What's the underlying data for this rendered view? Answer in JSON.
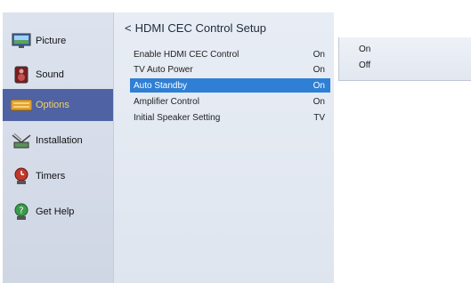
{
  "sidebar": {
    "items": [
      {
        "label": "Picture",
        "icon": "picture-icon",
        "selected": false
      },
      {
        "label": "Sound",
        "icon": "sound-icon",
        "selected": false
      },
      {
        "label": "Options",
        "icon": "options-icon",
        "selected": true
      },
      {
        "label": "Installation",
        "icon": "installation-icon",
        "selected": false
      },
      {
        "label": "Timers",
        "icon": "timers-icon",
        "selected": false
      },
      {
        "label": "Get Help",
        "icon": "help-icon",
        "selected": false
      }
    ]
  },
  "panel": {
    "back_glyph": "<",
    "title": "HDMI CEC Control Setup",
    "rows": [
      {
        "label": "Enable HDMI CEC  Control",
        "value": "On"
      },
      {
        "label": "TV Auto Power",
        "value": "On"
      },
      {
        "label": "Auto  Standby",
        "value": "On"
      },
      {
        "label": "Amplifier Control",
        "value": "On"
      },
      {
        "label": "Initial Speaker Setting",
        "value": "TV"
      }
    ],
    "highlighted_row": "Auto  Standby"
  },
  "popup": {
    "options": [
      "On",
      "Off"
    ]
  },
  "colors": {
    "highlight": "#2f7fd4",
    "sidebar_selected": "#4f62a3",
    "selected_text": "#f4d35e"
  }
}
